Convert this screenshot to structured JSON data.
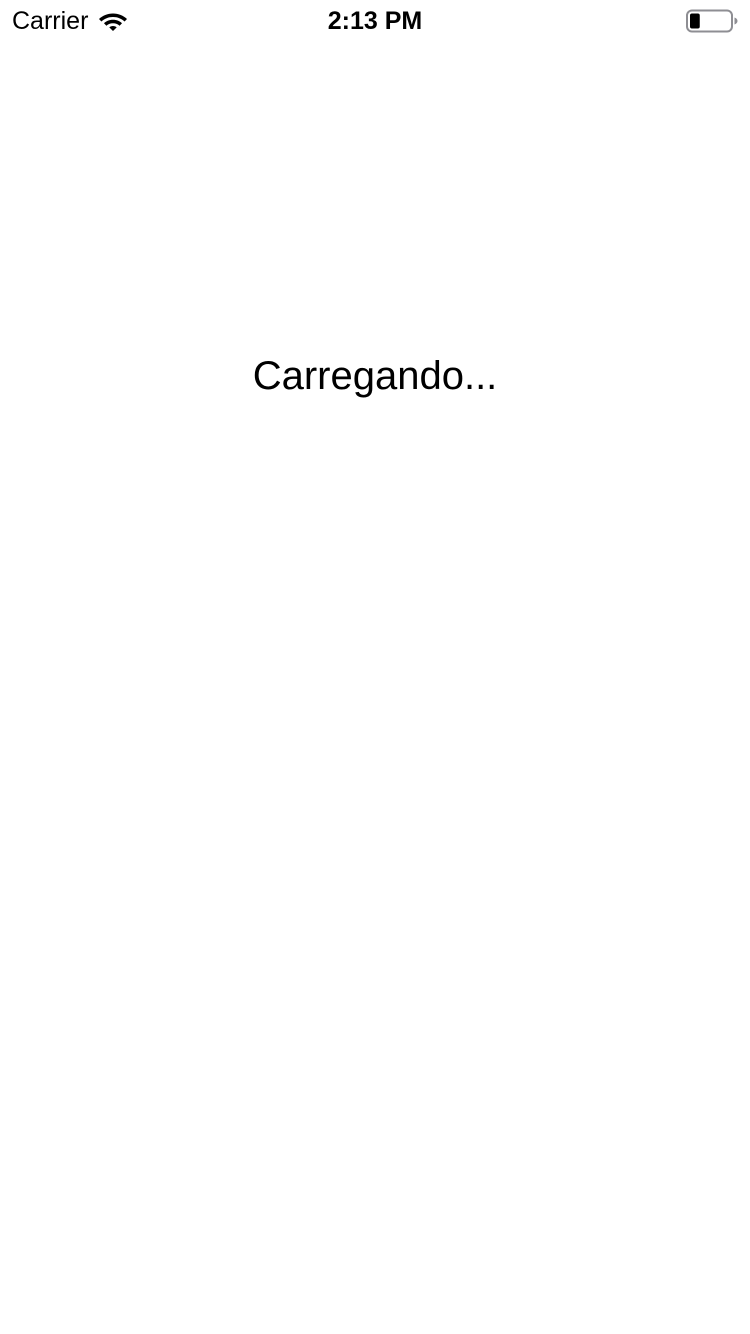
{
  "status_bar": {
    "carrier": "Carrier",
    "time": "2:13 PM",
    "wifi_icon": "wifi-icon",
    "battery_icon": "battery-icon",
    "battery_level": 0.25
  },
  "main": {
    "loading_text": "Carregando..."
  },
  "colors": {
    "background": "#ffffff",
    "text": "#000000",
    "battery_outline": "#8e8e93"
  }
}
